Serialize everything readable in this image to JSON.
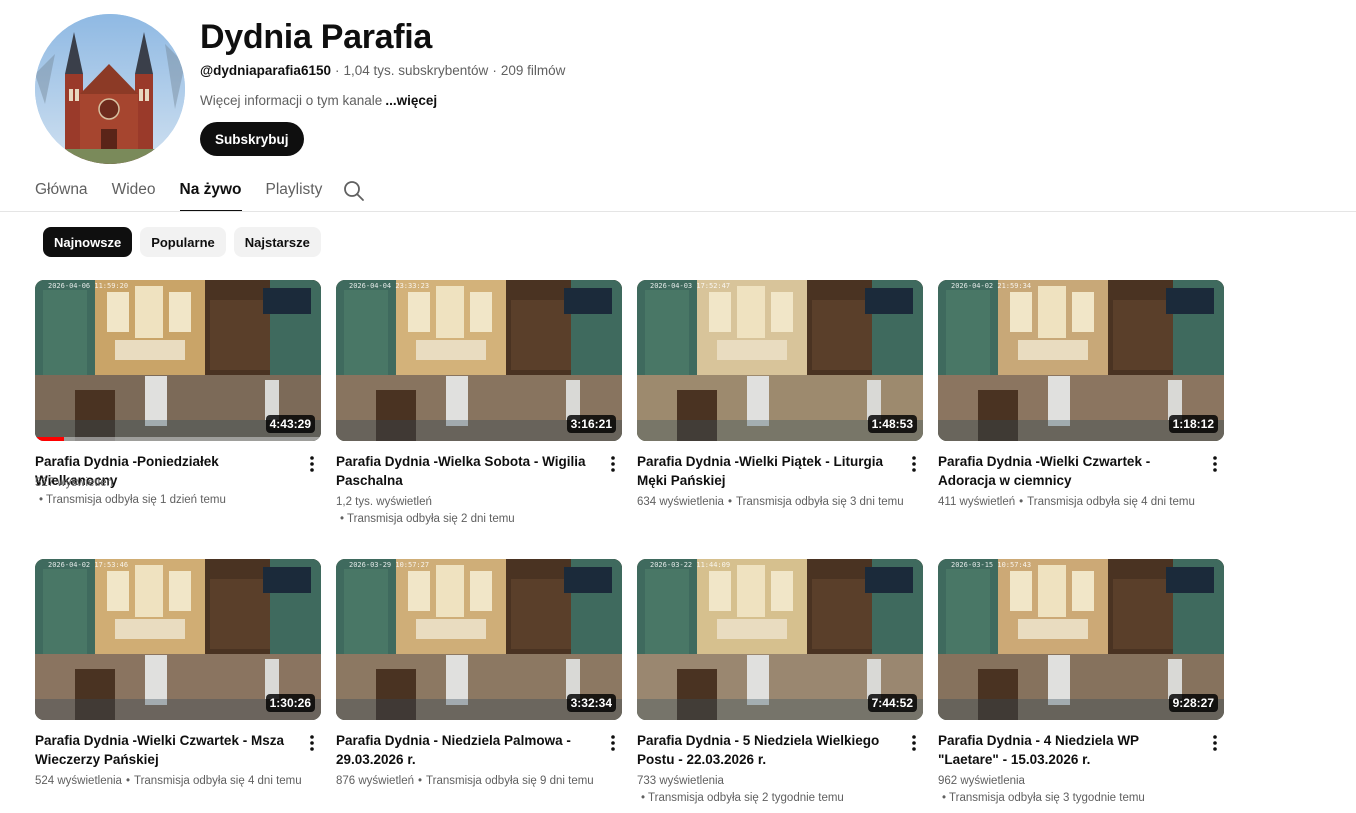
{
  "channel": {
    "name": "Dydnia Parafia",
    "handle": "@dydniaparafia6150",
    "subscribers": "1,04 tys. subskrybentów",
    "videos": "209 filmów",
    "about": "Więcej informacji o tym kanale",
    "about_more": "...więcej",
    "subscribe_label": "Subskrybuj"
  },
  "tabs": [
    {
      "label": "Główna"
    },
    {
      "label": "Wideo"
    },
    {
      "label": "Na żywo"
    },
    {
      "label": "Playlisty"
    }
  ],
  "active_tab": "Na żywo",
  "chips": [
    {
      "label": "Najnowsze"
    },
    {
      "label": "Popularne"
    },
    {
      "label": "Najstarsze"
    }
  ],
  "active_chip": "Najnowsze",
  "videos": [
    {
      "title": "Parafia Dydnia -Poniedziałek Wielkanocny",
      "views": "527 wyświetleń",
      "streamed": "Transmisja odbyła się 1 dzień temu",
      "duration": "4:43:29",
      "stamp": "2026-04-06 11:59:20",
      "watched": 0.1
    },
    {
      "title": "Parafia Dydnia -Wielka Sobota - Wigilia Paschalna",
      "views": "1,2 tys. wyświetleń",
      "streamed": "Transmisja odbyła się 2 dni temu",
      "duration": "3:16:21",
      "stamp": "2026-04-04 23:33:23"
    },
    {
      "title": "Parafia Dydnia -Wielki Piątek - Liturgia Męki Pańskiej",
      "views": "634 wyświetlenia",
      "streamed": "Transmisja odbyła się 3 dni temu",
      "duration": "1:48:53",
      "stamp": "2026-04-03 17:52:47",
      "music": true
    },
    {
      "title": "Parafia Dydnia -Wielki Czwartek - Adoracja w ciemnicy",
      "views": "411 wyświetleń",
      "streamed": "Transmisja odbyła się 4 dni temu",
      "duration": "1:18:12",
      "stamp": "2026-04-02 21:59:34"
    },
    {
      "title": "Parafia Dydnia -Wielki Czwartek - Msza Wieczerzy Pańskiej",
      "views": "524 wyświetlenia",
      "streamed": "Transmisja odbyła się 4 dni temu",
      "duration": "1:30:26",
      "stamp": "2026-04-02 17:53:46"
    },
    {
      "title": "Parafia Dydnia - Niedziela Palmowa - 29.03.2026 r.",
      "views": "876 wyświetleń",
      "streamed": "Transmisja odbyła się 9 dni temu",
      "duration": "3:32:34",
      "stamp": "2026-03-29 10:57:27"
    },
    {
      "title": "Parafia Dydnia - 5 Niedziela Wielkiego Postu - 22.03.2026 r.",
      "views": "733 wyświetlenia",
      "streamed": "Transmisja odbyła się 2 tygodnie temu",
      "duration": "7:44:52",
      "stamp": "2026-03-22 11:44:09"
    },
    {
      "title": "Parafia Dydnia - 4 Niedziela WP \"Laetare\" - 15.03.2026 r.",
      "views": "962 wyświetlenia",
      "streamed": "Transmisja odbyła się 3 tygodnie temu",
      "duration": "9:28:27",
      "stamp": "2026-03-15 10:57:43"
    }
  ]
}
